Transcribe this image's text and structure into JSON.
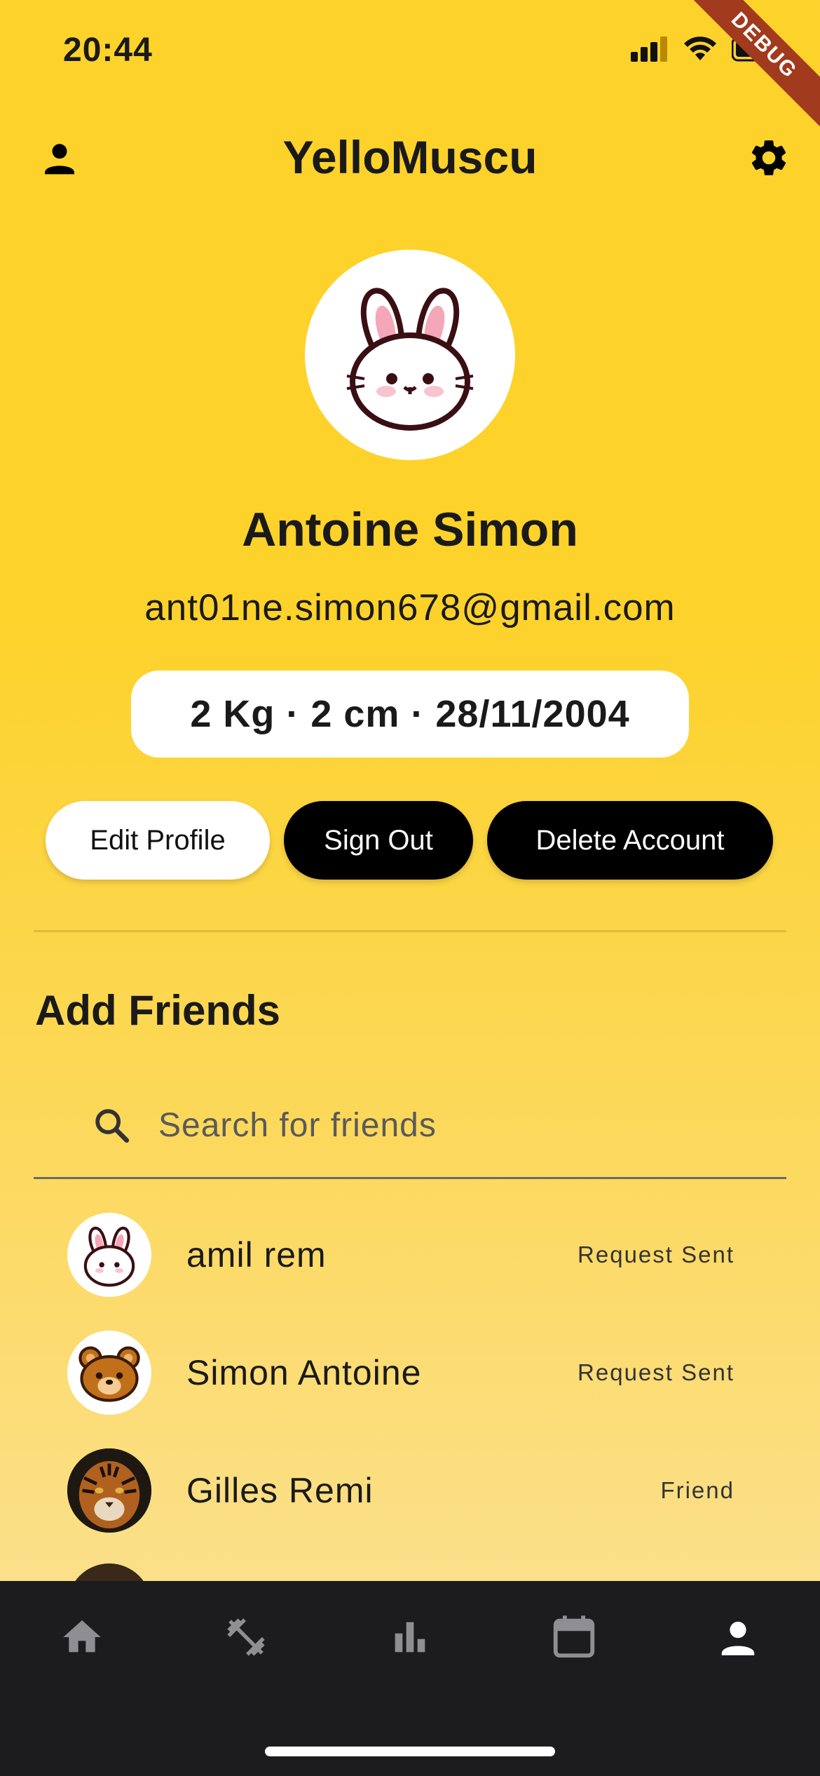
{
  "status_bar": {
    "time": "20:44",
    "debug_label": "DEBUG"
  },
  "app_bar": {
    "title": "YelloMuscu"
  },
  "profile": {
    "name": "Antoine Simon",
    "email": "ant01ne.simon678@gmail.com",
    "stats": "2 Kg ·  2 cm ·  28/11/2004"
  },
  "actions": {
    "edit_label": "Edit Profile",
    "signout_label": "Sign Out",
    "delete_label": "Delete Account"
  },
  "friends_section": {
    "title": "Add Friends",
    "search_placeholder": "Search for friends",
    "items": [
      {
        "name": "amil rem",
        "status": "Request Sent",
        "avatar": "bunny-avatar"
      },
      {
        "name": "Simon Antoine",
        "status": "Request Sent",
        "avatar": "bear-avatar"
      },
      {
        "name": "Gilles Remi",
        "status": "Friend",
        "avatar": "tiger-avatar"
      }
    ]
  },
  "bottom_nav": {
    "items": [
      {
        "icon": "home-icon",
        "active": false
      },
      {
        "icon": "dumbbell-icon",
        "active": false
      },
      {
        "icon": "bar-chart-icon",
        "active": false
      },
      {
        "icon": "calendar-icon",
        "active": false
      },
      {
        "icon": "person-icon",
        "active": true
      }
    ]
  },
  "colors": {
    "background": "#FDD22B",
    "nav_background": "#1c1c1e",
    "primary_button": "#000000"
  }
}
